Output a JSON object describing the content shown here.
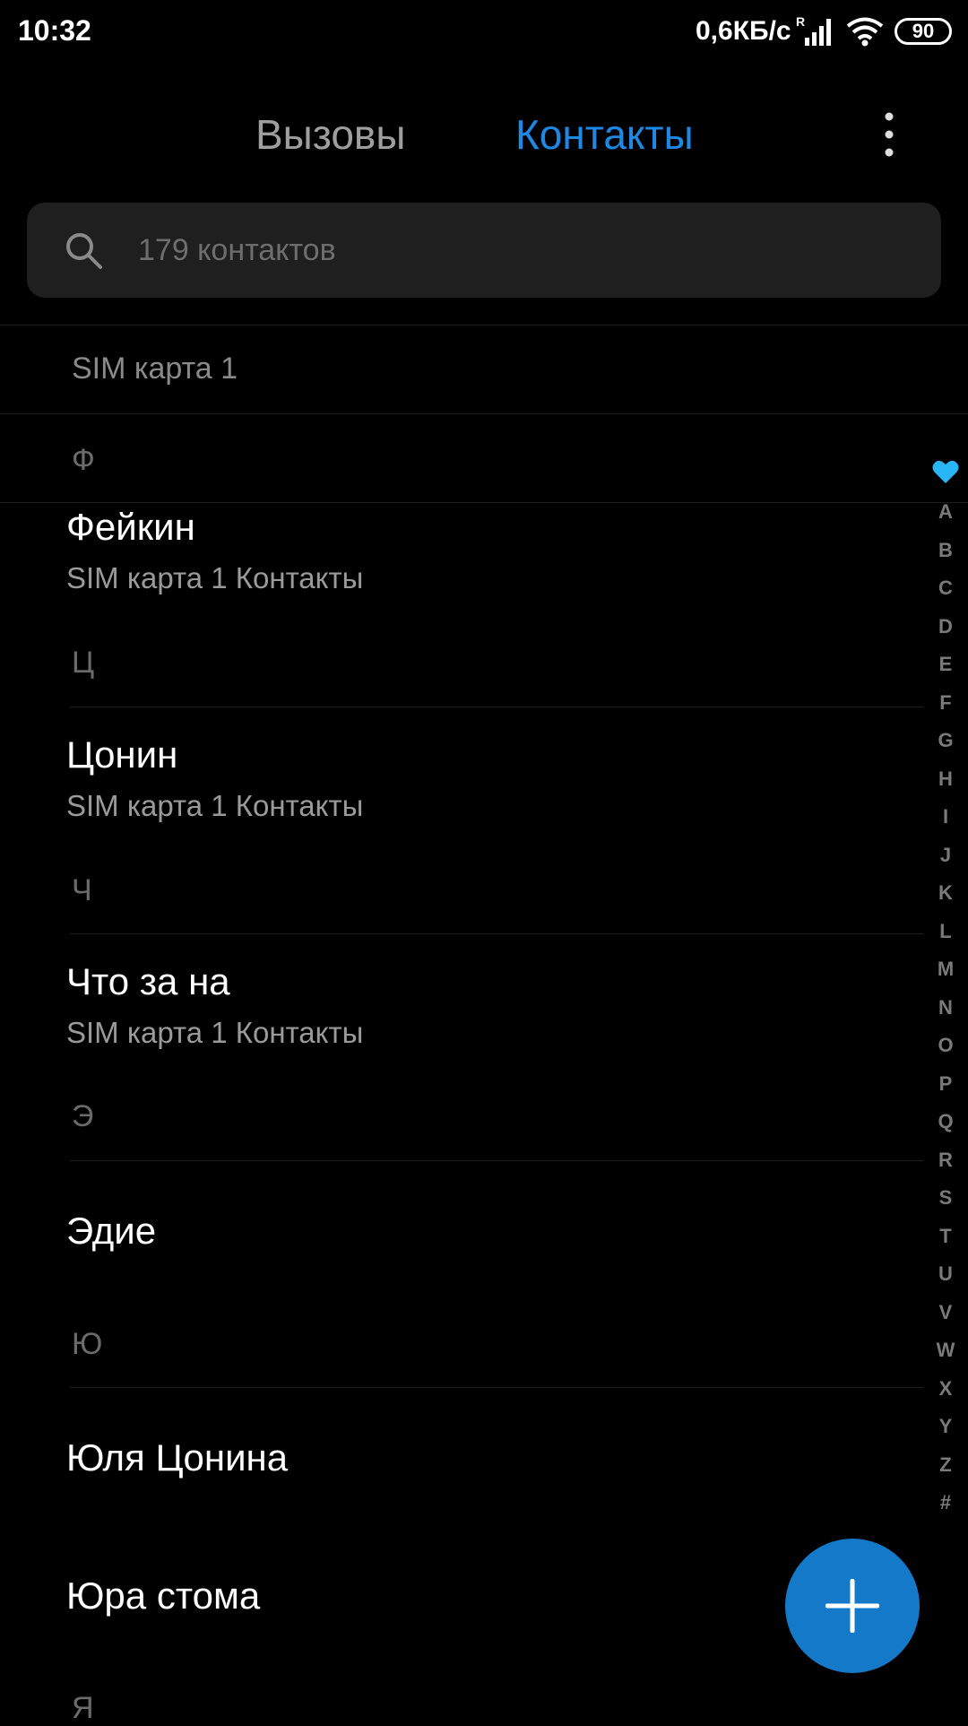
{
  "status_bar": {
    "time": "10:32",
    "net_speed": "0,6КБ/с",
    "signal_roaming": "R",
    "battery": "90"
  },
  "header": {
    "tabs": [
      {
        "label": "Вызовы",
        "active": false
      },
      {
        "label": "Контакты",
        "active": true
      }
    ],
    "more_icon": "more-vert-icon"
  },
  "search": {
    "placeholder": "179 контактов"
  },
  "list": {
    "sim_section": "SIM карта 1",
    "groups": [
      {
        "letter": "Ф",
        "contacts": [
          {
            "name": "Фейкин",
            "sub": "SIM карта 1 Контакты"
          }
        ]
      },
      {
        "letter": "Ц",
        "contacts": [
          {
            "name": "Цонин",
            "sub": "SIM карта 1 Контакты"
          }
        ]
      },
      {
        "letter": "Ч",
        "contacts": [
          {
            "name": "Что за на",
            "sub": "SIM карта 1 Контакты"
          }
        ]
      },
      {
        "letter": "Э",
        "contacts": [
          {
            "name": "Эдие",
            "sub": ""
          }
        ]
      },
      {
        "letter": "Ю",
        "contacts": [
          {
            "name": "Юля Цонина",
            "sub": ""
          },
          {
            "name": "Юра стома",
            "sub": ""
          }
        ]
      },
      {
        "letter": "Я",
        "contacts": []
      }
    ]
  },
  "index": {
    "favorite_icon": "heart-icon",
    "letters": [
      "A",
      "B",
      "C",
      "D",
      "E",
      "F",
      "G",
      "H",
      "I",
      "J",
      "K",
      "L",
      "M",
      "N",
      "O",
      "P",
      "Q",
      "R",
      "S",
      "T",
      "U",
      "V",
      "W",
      "X",
      "Y",
      "Z",
      "#"
    ]
  },
  "fab": {
    "icon": "plus-icon",
    "color": "#1479c9"
  },
  "colors": {
    "accent": "#1e88e5",
    "heart": "#29b6f6"
  }
}
